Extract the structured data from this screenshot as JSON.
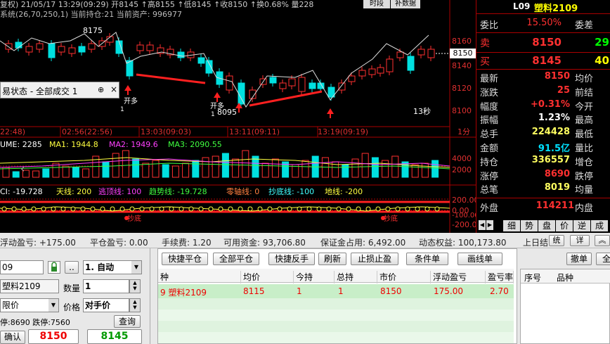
{
  "chart_header": {
    "title": "复权) 21/05/17 13:29(09:29) 开8145 ↑高8155 ↑低8145 ↑收8150 ↑换0.68% 量228",
    "tab_time": "时段",
    "tab_supp": "补数据",
    "subtitle": "系统(26,70,250,1)   当前持仓:21  当前资产: 996977"
  },
  "price_axis": [
    "8160",
    "8150",
    "8140",
    "8120",
    "8100"
  ],
  "price_current": "8150",
  "annotations": {
    "high_label": "8175",
    "low_label": "8095",
    "open_long": "开多",
    "open_long2": "开多",
    "one_a": "1",
    "one_b": "1",
    "secs": "13秒"
  },
  "time_axis": [
    "22:48)",
    "02:56(22:56)",
    "13:03(09:03)",
    "13:11(09:11)",
    "13:19(09:19)",
    "1分"
  ],
  "popup": {
    "title": "易状态 - 全部成交 1",
    "pin": "⊕",
    "close": "×"
  },
  "volume": {
    "label": "UME: 2285",
    "ma1": "MA1: 1944.8",
    "ma2": "MA2: 1949.6",
    "ma3": "MA3: 2090.55",
    "axis": [
      "4000",
      "2000",
      "0"
    ]
  },
  "indicator": {
    "cci": "CI: -19.728",
    "tianxian": "天线: 200",
    "taoding": "逃顶线: 100",
    "qushi": "趋势线: -19.728",
    "lingzhou": "零轴线: 0",
    "chaodi": "抄底线: -100",
    "dixian": "地线: -200",
    "axis": [
      "200.00",
      "0.00",
      "-100.00",
      "-200.00"
    ],
    "chaodi_1": "抄底",
    "chaodi_2": "抄底"
  },
  "quote": {
    "code": "L09",
    "name": "塑料2109",
    "wei_bi_label": "委比",
    "wei_bi": "15.50%",
    "wei_cha_label": "委差",
    "sell_label": "卖",
    "sell_price": "8150",
    "sell_vol": "29",
    "buy_label": "买",
    "buy_price": "8145",
    "buy_vol": "40",
    "rows": [
      {
        "l": "最新",
        "v": "8150",
        "c": "#ff3030",
        "r": "均价"
      },
      {
        "l": "涨跌",
        "v": "25",
        "c": "#ff3030",
        "r": "前结"
      },
      {
        "l": "幅度",
        "v": "+0.31%",
        "c": "#ff3030",
        "r": "今开"
      },
      {
        "l": "振幅",
        "v": "1.23%",
        "c": "#ffffff",
        "r": "最高"
      },
      {
        "l": "总手",
        "v": "224428",
        "c": "#ffff60",
        "r": "最低"
      },
      {
        "l": "金额",
        "v": "91.5亿",
        "c": "#00e0ff",
        "r": "量比"
      },
      {
        "l": "持仓",
        "v": "336557",
        "c": "#ffff60",
        "r": "增仓"
      },
      {
        "l": "涨停",
        "v": "8690",
        "c": "#ff3030",
        "r": "跌停"
      },
      {
        "l": "总笔",
        "v": "8019",
        "c": "#ffff60",
        "r": "均量"
      }
    ],
    "outer_label": "外盘",
    "outer": "114211",
    "inner_label": "内盘",
    "tabs": [
      "细",
      "势",
      "盘",
      "价",
      "逆",
      "成"
    ]
  },
  "trade": {
    "status": [
      "浮动盈亏: +175.00",
      "平仓盈亏: 0.00",
      "手续费: 1.20",
      "可用资金: 93,706.80",
      "保证金占用: 6,492.00",
      "动态权益: 100,173.80",
      "上日结"
    ],
    "status_btns": [
      "统",
      "详"
    ],
    "code_value": "09",
    "name_value": "塑料2109",
    "mode": "1. 自动",
    "qty_label": "数量",
    "qty": "1",
    "price_type": "限价",
    "price_label": "价格",
    "price_value": "对手价",
    "limit_text": "停:8690 跌停:7560",
    "query": "查询",
    "confirm": "确认",
    "sell_btn": "8150",
    "buy_btn": "8145",
    "actions": [
      "快捷平仓",
      "全部平仓",
      "快捷反手",
      "刷新",
      "止损止盈",
      "条件单",
      "画线单"
    ],
    "cancel": "撤单",
    "all": "全",
    "headers": [
      "种",
      "均价",
      "今持",
      "总持",
      "市价",
      "浮动盈亏",
      "盈亏率"
    ],
    "row": [
      "9 塑料2109",
      "8115",
      "1",
      "1",
      "8150",
      "175.00",
      "2.70"
    ],
    "right_headers": [
      "序号",
      "品种"
    ]
  },
  "colors": {
    "up": "#ff3030",
    "down": "#00e0e0",
    "accent": "#ffff00"
  }
}
